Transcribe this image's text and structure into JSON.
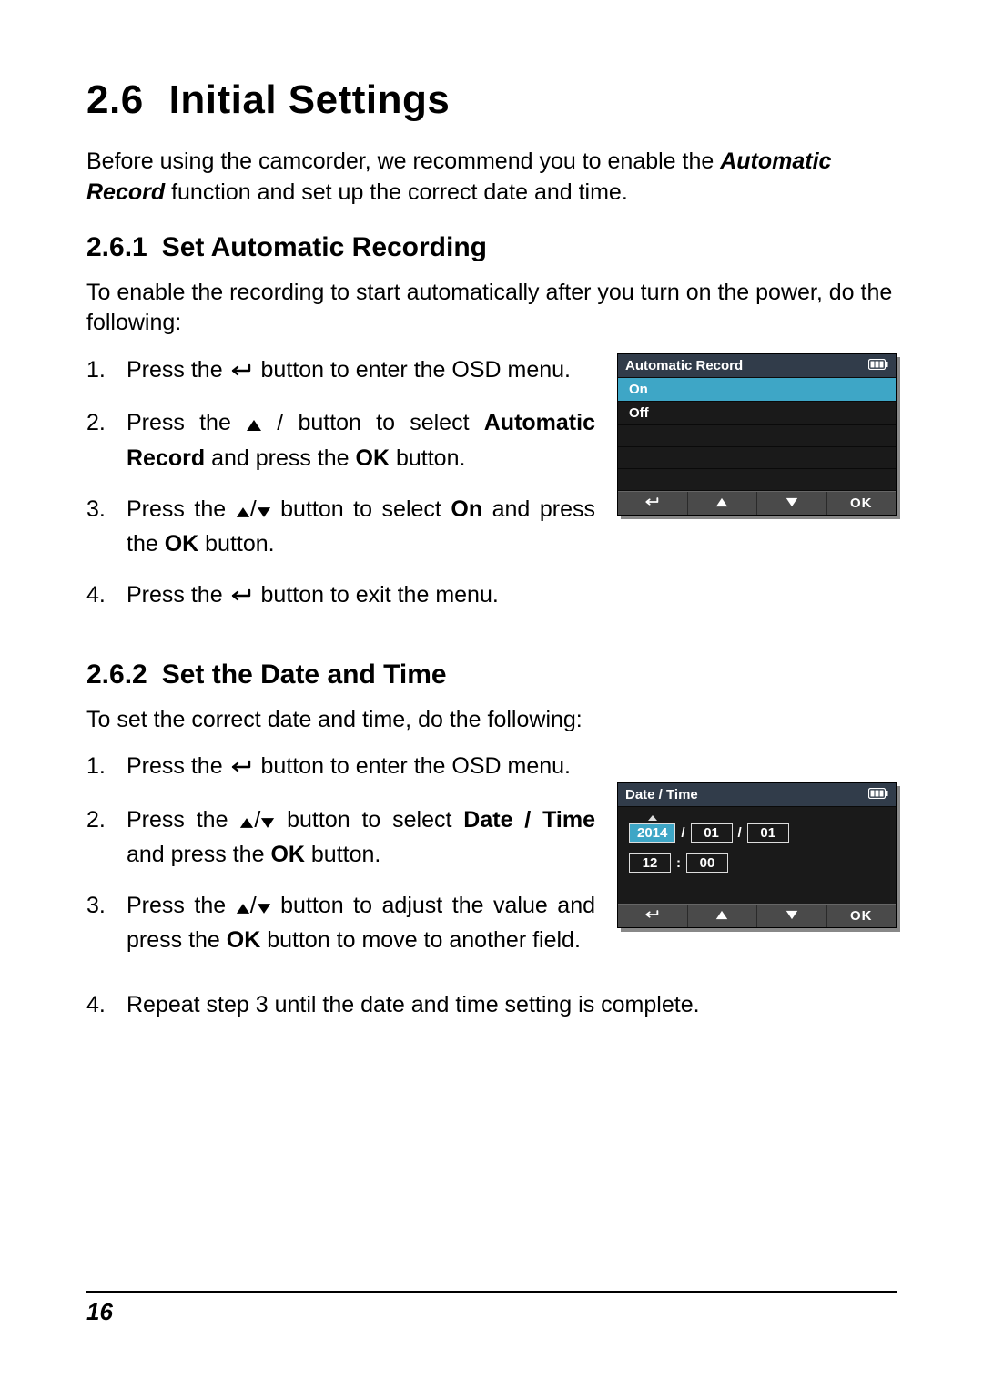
{
  "section": {
    "num": "2.6",
    "title": "Initial Settings"
  },
  "intro": {
    "line1": "Before using the camcorder, we recommend you to enable the ",
    "highlight": "Automatic Record",
    "line2": " function and set up the correct date and time."
  },
  "sub1": {
    "num": "2.6.1",
    "title": "Set Automatic Recording"
  },
  "sub1_lead": "To enable the recording to start automatically after you turn on the power, do the following:",
  "steps1": {
    "s1": {
      "n": "1.",
      "a": "Press the ",
      "b": " button to enter the OSD menu."
    },
    "s2": {
      "n": "2.",
      "a": "Press the ",
      "b": " / button to select ",
      "bold": "Automatic Record",
      "c": " and press the ",
      "d": " button."
    },
    "s3": {
      "n": "3.",
      "a": "Press the ",
      "mid": "/",
      "b": " button to select ",
      "bold": "On",
      "c": " and press the ",
      "d": "  button."
    },
    "s4": {
      "n": "4.",
      "a": "Press the ",
      "b": " button to exit the menu."
    }
  },
  "osd1": {
    "title": "Automatic Record",
    "on": "On",
    "off": "Off",
    "ok": "OK"
  },
  "sub2": {
    "num": "2.6.2",
    "title": "Set the Date and Time"
  },
  "sub2_lead": "To set the correct date and time, do the following:",
  "steps2": {
    "s1": {
      "n": "1.",
      "a": "Press the ",
      "b": " button to enter the OSD menu."
    },
    "s2": {
      "n": "2.",
      "a": "Press the ",
      "mid": "/",
      "b": "  button to select ",
      "bold": "Date / Time",
      "c": " and press the ",
      "d": "  button."
    },
    "s3": {
      "n": "3.",
      "a": "Press the ",
      "mid": "/",
      "b": " button to adjust the value and press the ",
      "d": " button to move to another field."
    },
    "s4": {
      "n": "4.",
      "t": "Repeat step 3 until the date and time setting is complete."
    }
  },
  "osd2": {
    "title": "Date / Time",
    "year": "2014",
    "month": "01",
    "day": "01",
    "hour": "12",
    "min": "00",
    "slash": "/",
    "colon": ":",
    "ok": "OK"
  },
  "ok_glyph": "OK",
  "page_number": "16"
}
